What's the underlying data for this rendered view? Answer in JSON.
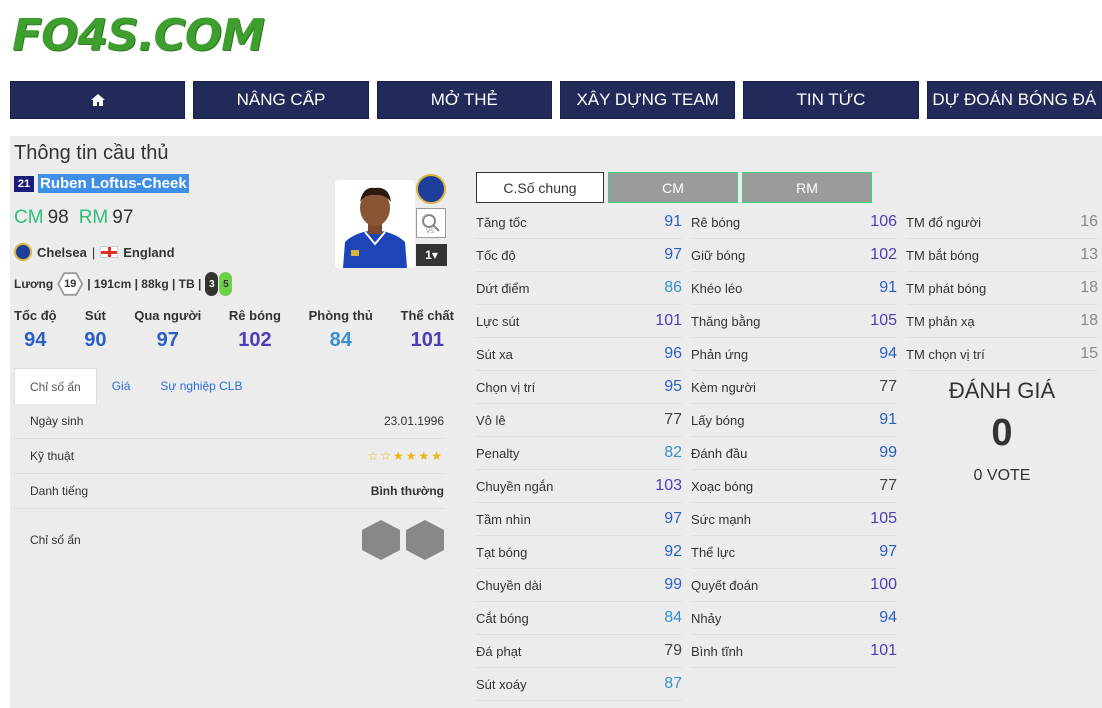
{
  "logo": "FO4S.COM",
  "nav": {
    "home_icon": "home-icon",
    "items": [
      "NÂNG CẤP",
      "MỞ THẺ",
      "XÂY DỰNG TEAM",
      "TIN TỨC",
      "DỰ ĐOÁN BÓNG ĐÁ"
    ]
  },
  "panel": {
    "title": "Thông tin cầu thủ",
    "player": {
      "season_number": "21",
      "name": "Ruben Loftus-Cheek",
      "positions": [
        {
          "pos": "CM",
          "ovr": "98"
        },
        {
          "pos": "RM",
          "ovr": "97"
        }
      ],
      "club": "Chelsea",
      "separator": "|",
      "nation": "England",
      "salary_label": "Lương",
      "salary": "19",
      "physique": "| 191cm | 88kg | TB |",
      "left_foot": "3",
      "right_foot": "5",
      "level": "1"
    },
    "main_stats": [
      {
        "label": "Tốc độ",
        "value": "94",
        "color": "#2a5fc4"
      },
      {
        "label": "Sút",
        "value": "90",
        "color": "#2a5fc4"
      },
      {
        "label": "Qua người",
        "value": "97",
        "color": "#2a5fc4"
      },
      {
        "label": "Rê bóng",
        "value": "102",
        "color": "#4a3fb8"
      },
      {
        "label": "Phòng thủ",
        "value": "84",
        "color": "#3a8fd0"
      },
      {
        "label": "Thể chất",
        "value": "101",
        "color": "#4a3fb8"
      }
    ],
    "tabs": [
      "Chỉ số ẩn",
      "Giá",
      "Sự nghiệp CLB"
    ],
    "info": {
      "dob_label": "Ngày sinh",
      "dob": "23.01.1996",
      "skill_label": "Kỹ thuật",
      "skill_stars": "☆☆★★★★",
      "rep_label": "Danh tiếng",
      "rep": "Bình thường",
      "traits_label": "Chỉ số ẩn"
    },
    "stat_buttons": [
      "C.Số chung",
      "CM",
      "RM"
    ],
    "stats_col1": [
      {
        "name": "Tăng tốc",
        "value": "91",
        "color": "#2a5fc4"
      },
      {
        "name": "Tốc độ",
        "value": "97",
        "color": "#2a5fc4"
      },
      {
        "name": "Dứt điểm",
        "value": "86",
        "color": "#3a8fd0"
      },
      {
        "name": "Lực sút",
        "value": "101",
        "color": "#4a3fb8"
      },
      {
        "name": "Sút xa",
        "value": "96",
        "color": "#2a5fc4"
      },
      {
        "name": "Chọn vị trí",
        "value": "95",
        "color": "#2a5fc4"
      },
      {
        "name": "Vô lê",
        "value": "77",
        "color": "#444444"
      },
      {
        "name": "Penalty",
        "value": "82",
        "color": "#3a8fd0"
      },
      {
        "name": "Chuyền ngắn",
        "value": "103",
        "color": "#4a3fb8"
      },
      {
        "name": "Tầm nhìn",
        "value": "97",
        "color": "#2a5fc4"
      },
      {
        "name": "Tạt bóng",
        "value": "92",
        "color": "#2a5fc4"
      },
      {
        "name": "Chuyền dài",
        "value": "99",
        "color": "#2a5fc4"
      },
      {
        "name": "Cắt bóng",
        "value": "84",
        "color": "#3a8fd0"
      },
      {
        "name": "Đá phạt",
        "value": "79",
        "color": "#444444"
      },
      {
        "name": "Sút xoáy",
        "value": "87",
        "color": "#3a8fd0"
      }
    ],
    "stats_col2": [
      {
        "name": "Rê bóng",
        "value": "106",
        "color": "#4a3fb8"
      },
      {
        "name": "Giữ bóng",
        "value": "102",
        "color": "#4a3fb8"
      },
      {
        "name": "Khéo léo",
        "value": "91",
        "color": "#2a5fc4"
      },
      {
        "name": "Thăng bằng",
        "value": "105",
        "color": "#4a3fb8"
      },
      {
        "name": "Phản ứng",
        "value": "94",
        "color": "#2a5fc4"
      },
      {
        "name": "Kèm người",
        "value": "77",
        "color": "#444444"
      },
      {
        "name": "Lấy bóng",
        "value": "91",
        "color": "#2a5fc4"
      },
      {
        "name": "Đánh đầu",
        "value": "99",
        "color": "#2a5fc4"
      },
      {
        "name": "Xoạc bóng",
        "value": "77",
        "color": "#444444"
      },
      {
        "name": "Sức mạnh",
        "value": "105",
        "color": "#4a3fb8"
      },
      {
        "name": "Thể lực",
        "value": "97",
        "color": "#2a5fc4"
      },
      {
        "name": "Quyết đoán",
        "value": "100",
        "color": "#4a3fb8"
      },
      {
        "name": "Nhảy",
        "value": "94",
        "color": "#2a5fc4"
      },
      {
        "name": "Bình tĩnh",
        "value": "101",
        "color": "#4a3fb8"
      }
    ],
    "stats_col3": [
      {
        "name": "TM đổ người",
        "value": "16",
        "color": "#888888"
      },
      {
        "name": "TM bắt bóng",
        "value": "13",
        "color": "#888888"
      },
      {
        "name": "TM phát bóng",
        "value": "18",
        "color": "#888888"
      },
      {
        "name": "TM phản xạ",
        "value": "18",
        "color": "#888888"
      },
      {
        "name": "TM chọn vị trí",
        "value": "15",
        "color": "#888888"
      }
    ],
    "rating": {
      "title": "ĐÁNH GIÁ",
      "score": "0",
      "votes": "0 VOTE"
    }
  }
}
